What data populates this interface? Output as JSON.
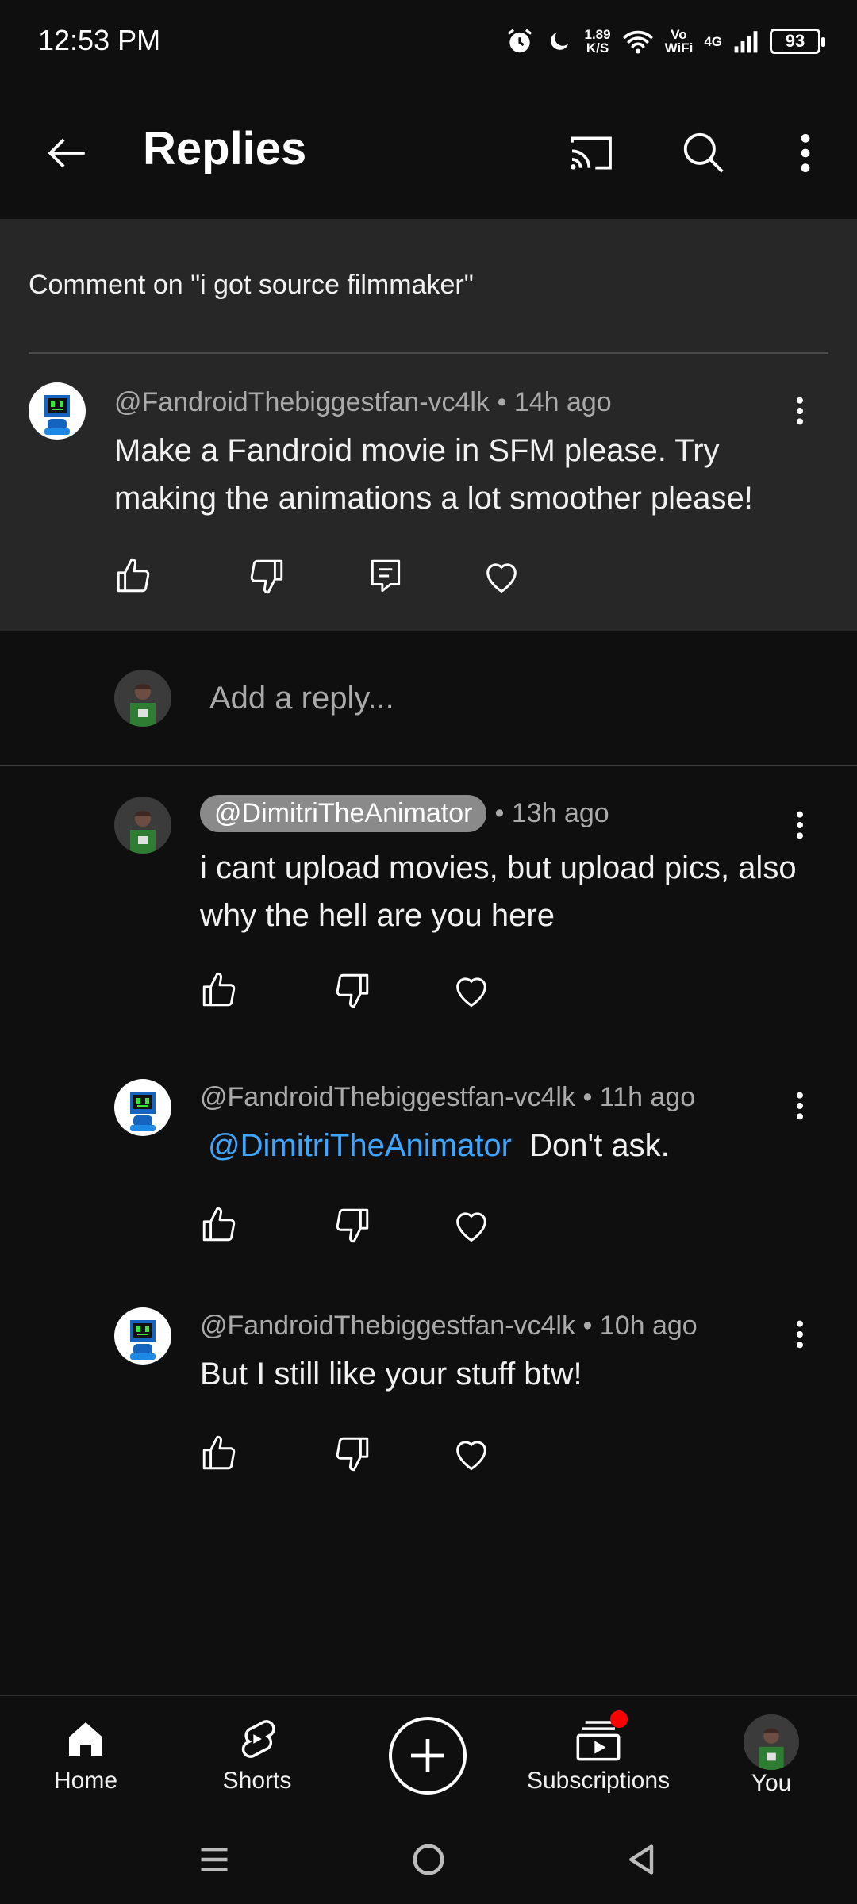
{
  "status_bar": {
    "time": "12:53 PM",
    "net_speed_top": "1.89",
    "net_speed_bottom": "K/S",
    "vo_top": "Vo",
    "vo_bottom": "WiFi",
    "network": "4G",
    "battery": "93"
  },
  "app_bar": {
    "title": "Replies",
    "icons": [
      "back-arrow-icon",
      "cast-icon",
      "search-icon",
      "more-vert-icon"
    ]
  },
  "parent": {
    "context": "Comment on \"i got source filmmaker\"",
    "author": "@FandroidThebiggestfan-vc4lk",
    "time": "• 14h ago",
    "text": "Make a Fandroid movie in SFM please. Try making the animations a lot smoother please!"
  },
  "reply_box": {
    "placeholder": "Add a reply..."
  },
  "replies": [
    {
      "author": "@DimitriTheAnimator",
      "time": "• 13h ago",
      "text": "i cant upload movies, but upload pics, also why the hell are you here"
    },
    {
      "author": "@FandroidThebiggestfan-vc4lk",
      "time": "• 11h ago",
      "mention": "@DimitriTheAnimator",
      "text": "Don't ask."
    },
    {
      "author": "@FandroidThebiggestfan-vc4lk",
      "time": "• 10h ago",
      "text": "But I still like your stuff btw!"
    }
  ],
  "bottom_nav": {
    "home": "Home",
    "shorts": "Shorts",
    "subscriptions": "Subscriptions",
    "you": "You"
  },
  "colors": {
    "background": "#0f0f0f",
    "parent_background": "#272727",
    "mention_link": "#3ea6ff",
    "notification_dot": "#ff0000"
  }
}
